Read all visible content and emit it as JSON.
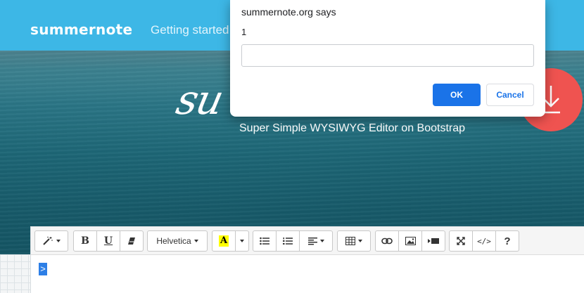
{
  "navbar": {
    "brand": "summernote",
    "links": [
      "Getting started"
    ]
  },
  "hero": {
    "logo_text": "su",
    "tagline": "Super Simple WYSIWYG Editor on Bootstrap"
  },
  "download_button": {
    "icon": "download-arrow-icon",
    "color": "#ef5350"
  },
  "toolbar": {
    "style_icon": "magic-wand-icon",
    "bold_label": "B",
    "underline_label": "U",
    "clear_icon": "eraser-icon",
    "font_name": "Helvetica",
    "color_label": "A",
    "ul_icon": "unordered-list-icon",
    "ol_icon": "ordered-list-icon",
    "align_icon": "align-left-icon",
    "table_icon": "table-icon",
    "link_icon": "link-icon",
    "picture_icon": "picture-icon",
    "video_icon": "video-icon",
    "fullscreen_icon": "fullscreen-icon",
    "codeview_label": "</>",
    "help_label": "?"
  },
  "editor": {
    "content": ">"
  },
  "dialog": {
    "title": "summernote.org says",
    "message": "1",
    "input_value": "",
    "ok_label": "OK",
    "cancel_label": "Cancel"
  },
  "colors": {
    "navbar": "#3db7e6",
    "download": "#ef5350",
    "ok_button": "#1a73e8"
  }
}
